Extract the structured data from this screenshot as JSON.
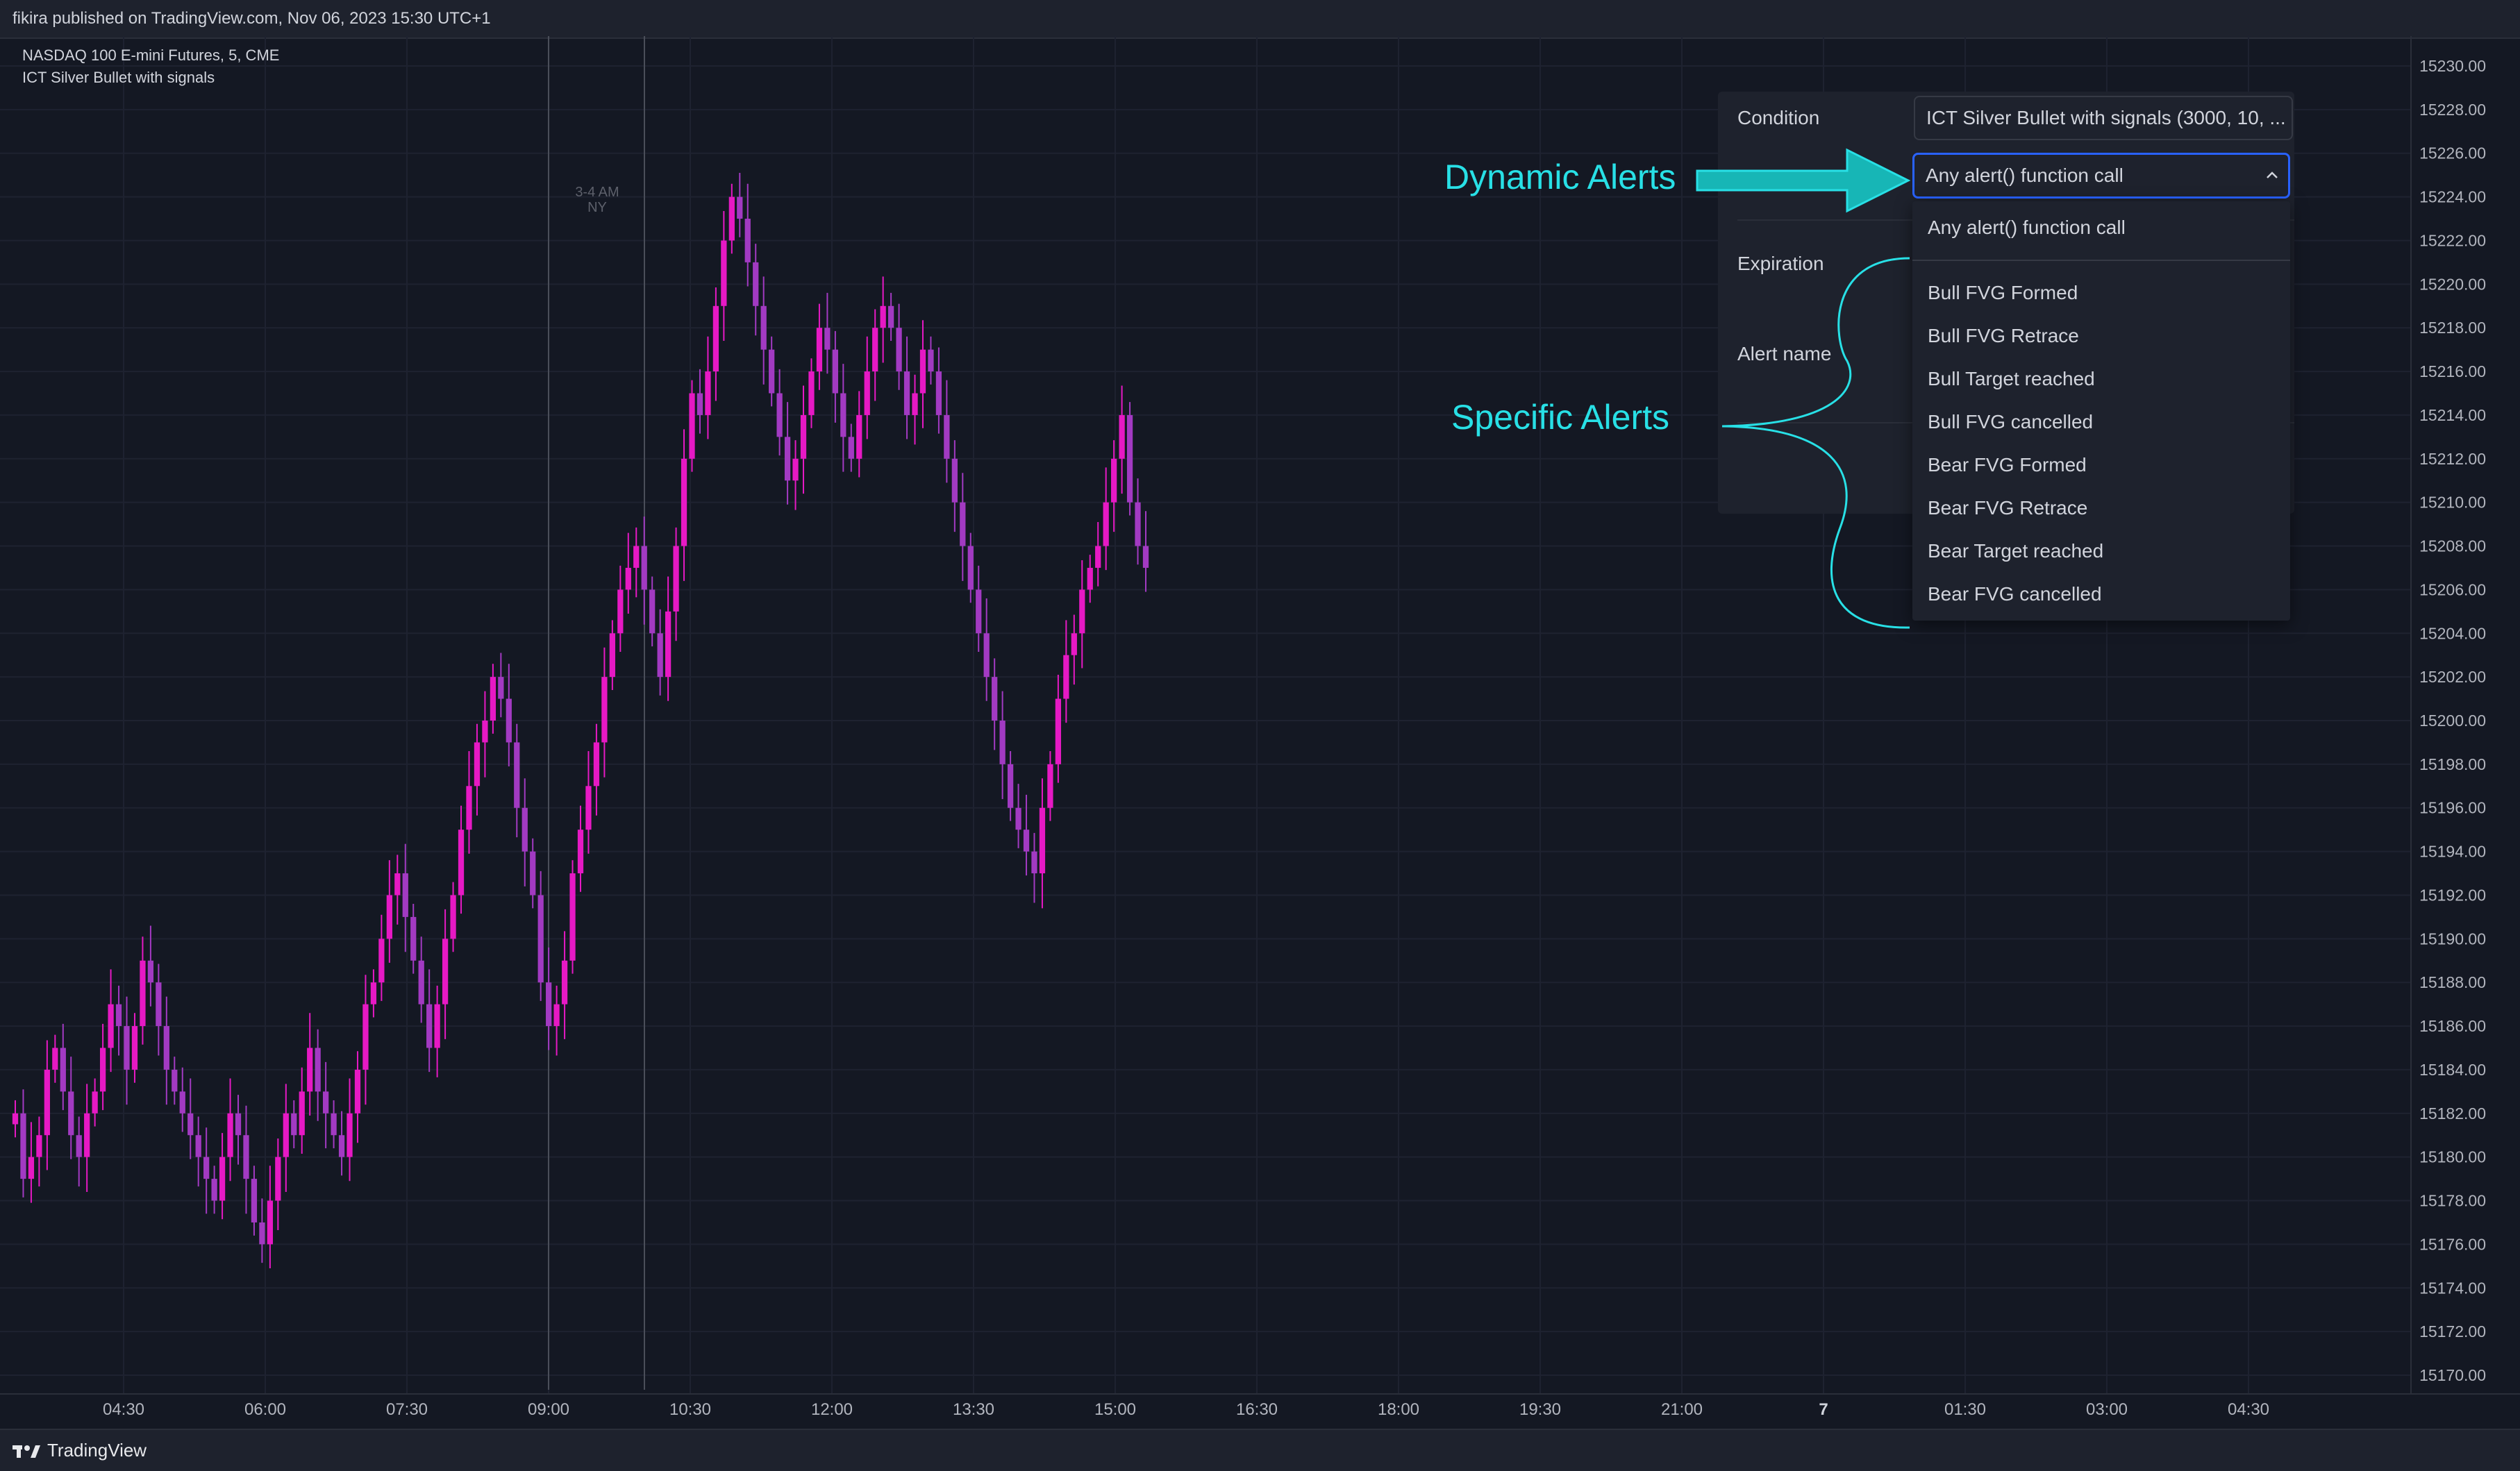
{
  "header": {
    "published_line": "fikira published on TradingView.com, Nov 06, 2023 15:30 UTC+1"
  },
  "legend": {
    "symbol_line": "NASDAQ 100 E-mini Futures, 5, CME",
    "indicator_line": "ICT Silver Bullet with signals"
  },
  "session": {
    "line1": "3-4 AM",
    "line2": "NY"
  },
  "footer": {
    "brand": "TradingView"
  },
  "alert_dialog": {
    "condition_label": "Condition",
    "condition_value": "ICT Silver Bullet with signals (3000, 10, ...",
    "selected_alert": "Any alert() function call",
    "expiration_label": "Expiration",
    "alert_name_label": "Alert name",
    "dropdown_items": [
      "Any alert() function call",
      "Bull FVG Formed",
      "Bull FVG Retrace",
      "Bull Target reached",
      "Bull FVG cancelled",
      "Bear FVG Formed",
      "Bear FVG Retrace",
      "Bear Target reached",
      "Bear FVG cancelled"
    ]
  },
  "annotations": {
    "dynamic": "Dynamic Alerts",
    "specific": "Specific Alerts"
  },
  "colors": {
    "background": "#141823",
    "candle": "#e619c4",
    "accent_blue": "#2962ff",
    "annotation": "#28e0e6"
  },
  "chart_data": {
    "type": "candlestick",
    "symbol": "NASDAQ 100 E-mini Futures",
    "interval": "5",
    "exchange": "CME",
    "x_ticks": [
      "04:30",
      "06:00",
      "07:30",
      "09:00",
      "10:30",
      "12:00",
      "13:30",
      "15:00",
      "16:30",
      "18:00",
      "19:30",
      "21:00",
      "7",
      "01:30",
      "03:00",
      "04:30"
    ],
    "y_ticks": [
      "15230.00",
      "15228.00",
      "15226.00",
      "15224.00",
      "15222.00",
      "15220.00",
      "15218.00",
      "15216.00",
      "15214.00",
      "15212.00",
      "15210.00",
      "15208.00",
      "15206.00",
      "15204.00",
      "15202.00",
      "15200.00",
      "15198.00",
      "15196.00",
      "15194.00",
      "15192.00",
      "15190.00",
      "15188.00",
      "15186.00",
      "15184.00",
      "15182.00",
      "15180.00",
      "15178.00",
      "15176.00",
      "15174.00",
      "15172.00",
      "15170.00"
    ],
    "ylim": [
      15169,
      15231
    ],
    "grid": true,
    "closes": [
      15182,
      15179,
      15180,
      15181,
      15184,
      15185,
      15183,
      15181,
      15180,
      15182,
      15183,
      15185,
      15187,
      15186,
      15184,
      15186,
      15189,
      15188,
      15186,
      15184,
      15183,
      15182,
      15181,
      15180,
      15179,
      15178,
      15180,
      15182,
      15181,
      15179,
      15177,
      15176,
      15178,
      15180,
      15182,
      15181,
      15183,
      15185,
      15183,
      15182,
      15181,
      15180,
      15182,
      15184,
      15187,
      15188,
      15190,
      15192,
      15193,
      15191,
      15189,
      15187,
      15185,
      15187,
      15190,
      15192,
      15195,
      15197,
      15199,
      15200,
      15202,
      15201,
      15199,
      15196,
      15194,
      15192,
      15188,
      15186,
      15187,
      15189,
      15193,
      15195,
      15197,
      15199,
      15202,
      15204,
      15206,
      15207,
      15208,
      15206,
      15204,
      15202,
      15205,
      15208,
      15212,
      15215,
      15214,
      15216,
      15219,
      15222,
      15224,
      15223,
      15221,
      15219,
      15217,
      15215,
      15213,
      15211,
      15212,
      15214,
      15216,
      15218,
      15217,
      15215,
      15213,
      15212,
      15214,
      15216,
      15218,
      15219,
      15218,
      15216,
      15214,
      15215,
      15217,
      15216,
      15214,
      15212,
      15210,
      15208,
      15206,
      15204,
      15202,
      15200,
      15198,
      15196,
      15195,
      15194,
      15193,
      15196,
      15198,
      15201,
      15203,
      15204,
      15206,
      15207,
      15208,
      15210,
      15212,
      15214,
      15210,
      15208,
      15207
    ]
  }
}
